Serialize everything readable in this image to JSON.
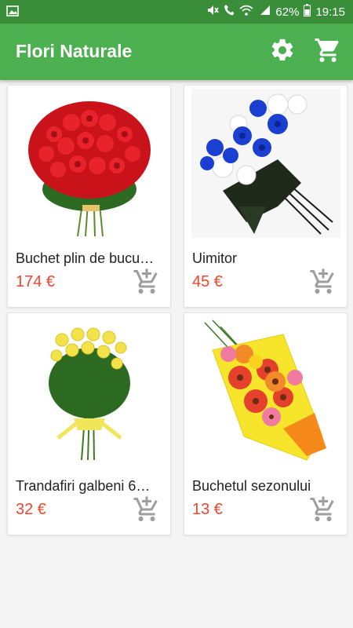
{
  "status_bar": {
    "battery": "62%",
    "time": "19:15",
    "left_icon": "image-icon"
  },
  "app_bar": {
    "title": "Flori Naturale",
    "settings_icon": "gear-icon",
    "cart_icon": "cart-icon"
  },
  "products": [
    {
      "name": "Buchet plin de bucu…",
      "price": "174 €"
    },
    {
      "name": "Uimitor",
      "price": "45 €"
    },
    {
      "name": "Trandafiri galbeni 6…",
      "price": "32 €"
    },
    {
      "name": "Buchetul sezonului",
      "price": "13 €"
    }
  ],
  "colors": {
    "status_bar": "#3a8e3a",
    "app_bar": "#4caf50",
    "price": "#f2452c",
    "icon_gray": "#9e9e9e"
  }
}
